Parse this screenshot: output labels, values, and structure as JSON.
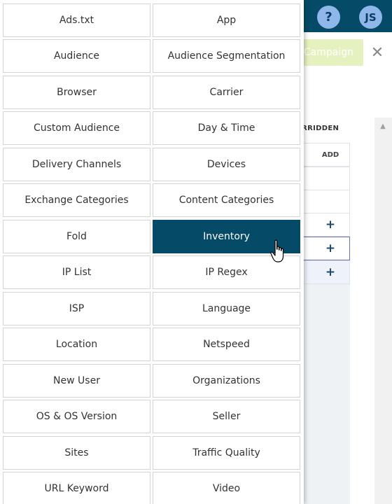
{
  "header": {
    "help_label": "?",
    "user_initials": "JS"
  },
  "actions": {
    "campaign_label": "Campaign",
    "close_label": "✕"
  },
  "table": {
    "column_header": "ERRIDDEN",
    "add_header": "ADD",
    "rows": [
      "",
      "",
      "+",
      "+",
      "+"
    ]
  },
  "targeting_options": [
    "Ads.txt",
    "App",
    "Audience",
    "Audience Segmentation",
    "Browser",
    "Carrier",
    "Custom Audience",
    "Day & Time",
    "Delivery Channels",
    "Devices",
    "Exchange Categories",
    "Content Categories",
    "Fold",
    "Inventory",
    "IP List",
    "IP Regex",
    "ISP",
    "Language",
    "Location",
    "Netspeed",
    "New User",
    "Organizations",
    "OS & OS Version",
    "Seller",
    "Sites",
    "Traffic Quality",
    "URL Keyword",
    "Video"
  ],
  "active_option": "Inventory",
  "colors": {
    "accent": "#054a66",
    "campaign_button": "#e5f2c0",
    "avatar_bg": "#8fb7ea"
  }
}
